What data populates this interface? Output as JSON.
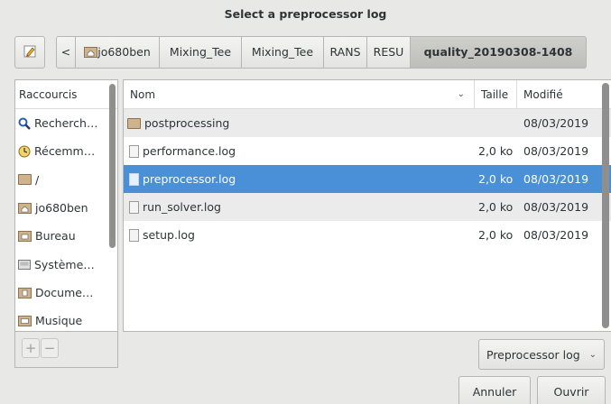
{
  "window": {
    "title": "Select a preprocessor log"
  },
  "pathbar": {
    "back_label": "<",
    "segments": [
      "jo680ben",
      "Mixing_Tee",
      "Mixing_Tee",
      "RANS",
      "RESU",
      "quality_20190308-1408"
    ]
  },
  "sidebar": {
    "header": "Raccourcis",
    "items": [
      {
        "label": "Recherch…",
        "icon": "search-icon"
      },
      {
        "label": "Récemm…",
        "icon": "recent-clock-icon"
      },
      {
        "label": "/",
        "icon": "folder-icon"
      },
      {
        "label": "jo680ben",
        "icon": "home-folder-icon"
      },
      {
        "label": "Bureau",
        "icon": "desktop-folder-icon"
      },
      {
        "label": "Système…",
        "icon": "drive-icon"
      },
      {
        "label": "Docume…",
        "icon": "documents-folder-icon"
      },
      {
        "label": "Musique",
        "icon": "music-folder-icon"
      }
    ],
    "add_label": "+",
    "remove_label": "−"
  },
  "filelist": {
    "columns": {
      "name": "Nom",
      "size": "Taille",
      "modified": "Modifié"
    },
    "rows": [
      {
        "name": "postprocessing",
        "size": "",
        "modified": "08/03/2019",
        "type": "folder"
      },
      {
        "name": "performance.log",
        "size": "2,0 ko",
        "modified": "08/03/2019",
        "type": "file"
      },
      {
        "name": "preprocessor.log",
        "size": "2,0 ko",
        "modified": "08/03/2019",
        "type": "file",
        "selected": true
      },
      {
        "name": "run_solver.log",
        "size": "2,0 ko",
        "modified": "08/03/2019",
        "type": "file"
      },
      {
        "name": "setup.log",
        "size": "2,0 ko",
        "modified": "08/03/2019",
        "type": "file"
      }
    ]
  },
  "filter": {
    "value": "Preprocessor log"
  },
  "actions": {
    "cancel": "Annuler",
    "open": "Ouvrir"
  },
  "colors": {
    "selection": "#4a90d9"
  }
}
